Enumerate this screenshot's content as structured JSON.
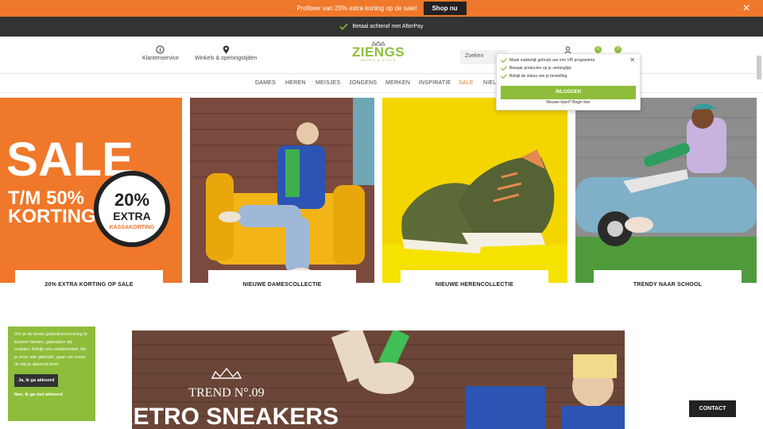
{
  "promo_bar": {
    "text": "Profiteer van 20% extra korting op de sale!",
    "button": "Shop nu",
    "close": "✕"
  },
  "usp_bar": {
    "text": "Betaal achteraf met AfterPay"
  },
  "header": {
    "service_label": "Klantenservice",
    "stores_label": "Winkels & openingstijden",
    "logo_text": "ZIENGS",
    "logo_tagline": "SHOES & STYLE",
    "search_placeholder": "Zoeken",
    "wishlist_count": "0",
    "cart_count": "0"
  },
  "nav": {
    "items": [
      "DAMES",
      "HEREN",
      "MEISJES",
      "JONGENS",
      "MERKEN",
      "INSPIRATIE",
      "SALE",
      "NIEU"
    ]
  },
  "login_popup": {
    "benefits": [
      "Maak makkelijk gebruik van ons VIP programma",
      "Bewaar producten op je verlanglijst",
      "Bekijk de status van je bestelling"
    ],
    "login_button": "INLOGGEN",
    "register_text": "Nieuwe klant? Begin hier"
  },
  "tiles": [
    {
      "caption": "20% EXTRA KORTING OP SALE",
      "sale_big": "SALE",
      "sale_line1": "T/M 50%",
      "sale_line2": "KORTING",
      "badge_pct": "20%",
      "badge_word": "EXTRA",
      "badge_sub": "KASSAKORTING"
    },
    {
      "caption": "NIEUWE DAMESCOLLECTIE"
    },
    {
      "caption": "NIEUWE HERENCOLLECTIE"
    },
    {
      "caption": "TRENDY NAAR SCHOOL"
    }
  ],
  "banner": {
    "trend": "TREND N°.09",
    "title": "RETRO SNEAKERS"
  },
  "cookie": {
    "text": "Om je de beste gebruikerservaring te kunnen bieden, gebruiken wij cookies. Bekijk ons cookiebeleid. Als je onze site gebruikt, gaan we ervan uit dat je akkoord bent.",
    "accept": "Ja, ik ga akkoord",
    "decline": "Nee, ik ga niet akkoord"
  },
  "contact_button": "CONTACT",
  "colors": {
    "brand_green": "#8dbd3a",
    "promo_orange": "#f0782a",
    "dark": "#333333"
  }
}
